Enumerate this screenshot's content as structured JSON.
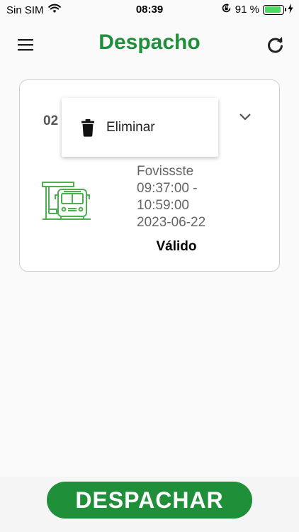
{
  "status_bar": {
    "carrier": "Sin SIM",
    "time": "08:39",
    "battery_percent": "91 %",
    "battery_level": 0.91,
    "icons": [
      "wifi-icon",
      "orientation-lock-icon",
      "battery-icon",
      "charging-icon"
    ]
  },
  "header": {
    "title": "Despacho",
    "menu_icon": "hamburger-menu-icon",
    "refresh_icon": "refresh-icon"
  },
  "card": {
    "code": "02",
    "expand_icon": "chevron-down-icon",
    "illustration_icon": "bus-stop-icon",
    "station": "Fovissste",
    "time_start": "09:37:00  -",
    "time_end": "10:59:00",
    "date": "2023-06-22",
    "status": "Válido"
  },
  "popup_menu": {
    "items": [
      {
        "label": "Eliminar",
        "icon": "trash-icon"
      }
    ]
  },
  "footer": {
    "dispatch_label": "DESPACHAR"
  },
  "colors": {
    "brand_green": "#1f8f3a",
    "icon_green": "#4caf50",
    "background": "#fafafa"
  }
}
